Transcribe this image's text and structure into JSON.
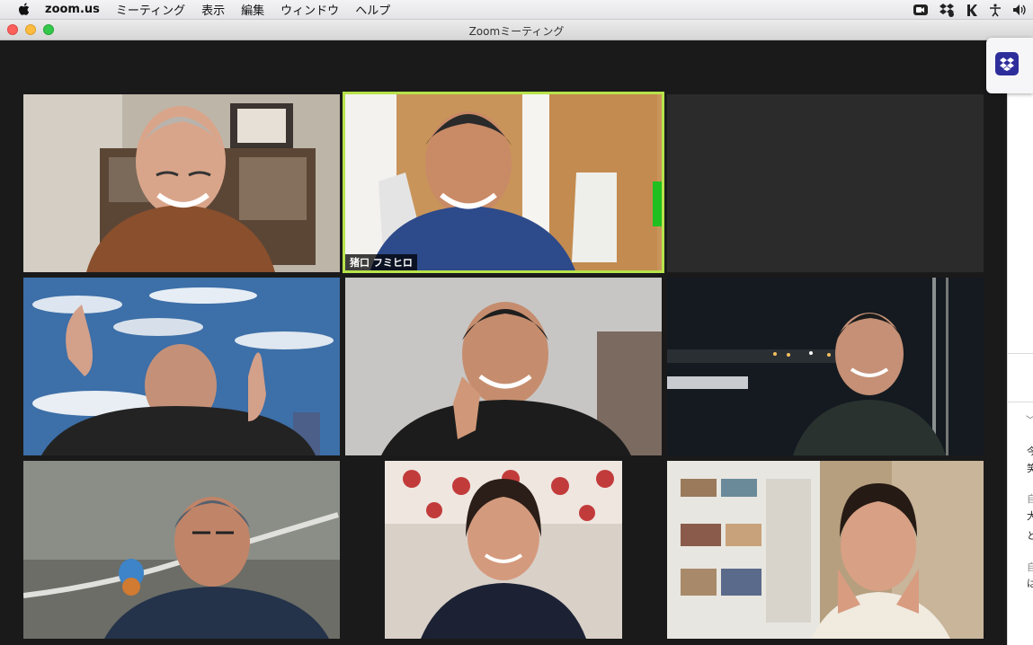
{
  "menubar": {
    "app_name": "zoom.us",
    "items": [
      "ミーティング",
      "表示",
      "編集",
      "ウィンドウ",
      "ヘルプ"
    ]
  },
  "window": {
    "title": "Zoomミーティング"
  },
  "status_icons": [
    "zoom-video-icon",
    "dropbox-sync-icon",
    "k-app-icon",
    "accessibility-icon",
    "volume-icon"
  ],
  "participants": [
    {
      "id": "p1",
      "name": ""
    },
    {
      "id": "p2",
      "name": "猪口 フミヒロ",
      "speaking": true
    },
    {
      "id": "p3",
      "name": ""
    },
    {
      "id": "p4",
      "name": ""
    },
    {
      "id": "p5",
      "name": ""
    },
    {
      "id": "p6",
      "name": ""
    },
    {
      "id": "p7",
      "name": ""
    },
    {
      "id": "p8",
      "name": ""
    }
  ],
  "side_panel": {
    "rows": [
      "今",
      "笑",
      "自",
      "大",
      "と",
      "自",
      "は"
    ]
  },
  "colors": {
    "active_speaker_border": "#b7e34a",
    "background": "#1a1a1a",
    "dropbox": "#2d2d9b"
  }
}
